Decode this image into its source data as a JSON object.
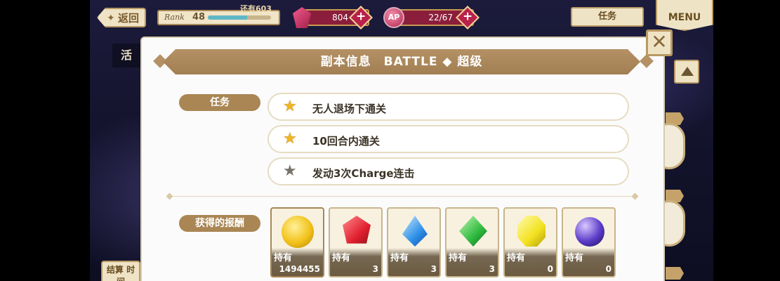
{
  "hud": {
    "back_label": "返回",
    "rank_label": "Rank",
    "rank_value": "48",
    "rank_note": "还有603",
    "rank_progress": 0.62,
    "gems": "804",
    "ap_icon_label": "AP",
    "ap": "22/67",
    "plus": "+",
    "task_label": "任务",
    "menu_label": "MENU"
  },
  "background": {
    "tab_label": "活",
    "bottom_button": "结算 时间"
  },
  "dialog": {
    "title": "副本信息　BATTLE ◆ 超级",
    "close": "✕",
    "missions_label": "任务",
    "missions": [
      {
        "text": "无人退场下通关",
        "completed": true
      },
      {
        "text": "10回合内通关",
        "completed": true
      },
      {
        "text": "发动3次Charge连击",
        "completed": false
      }
    ],
    "rewards_label": "获得的报酬",
    "owned_label": "持有",
    "rewards": [
      {
        "icon": "gold-coin-icon",
        "owned": "1494455"
      },
      {
        "icon": "red-gem-icon",
        "owned": "3"
      },
      {
        "icon": "blue-gem-icon",
        "owned": "3"
      },
      {
        "icon": "green-gem-icon",
        "owned": "3"
      },
      {
        "icon": "yellow-gem-icon",
        "owned": "0"
      },
      {
        "icon": "purple-orb-icon",
        "owned": "0"
      }
    ]
  },
  "colors": {
    "accent_gold": "#a98654",
    "star_on": "#f1b521",
    "star_off": "#77726a",
    "gem_red": "#8b1e3b"
  }
}
